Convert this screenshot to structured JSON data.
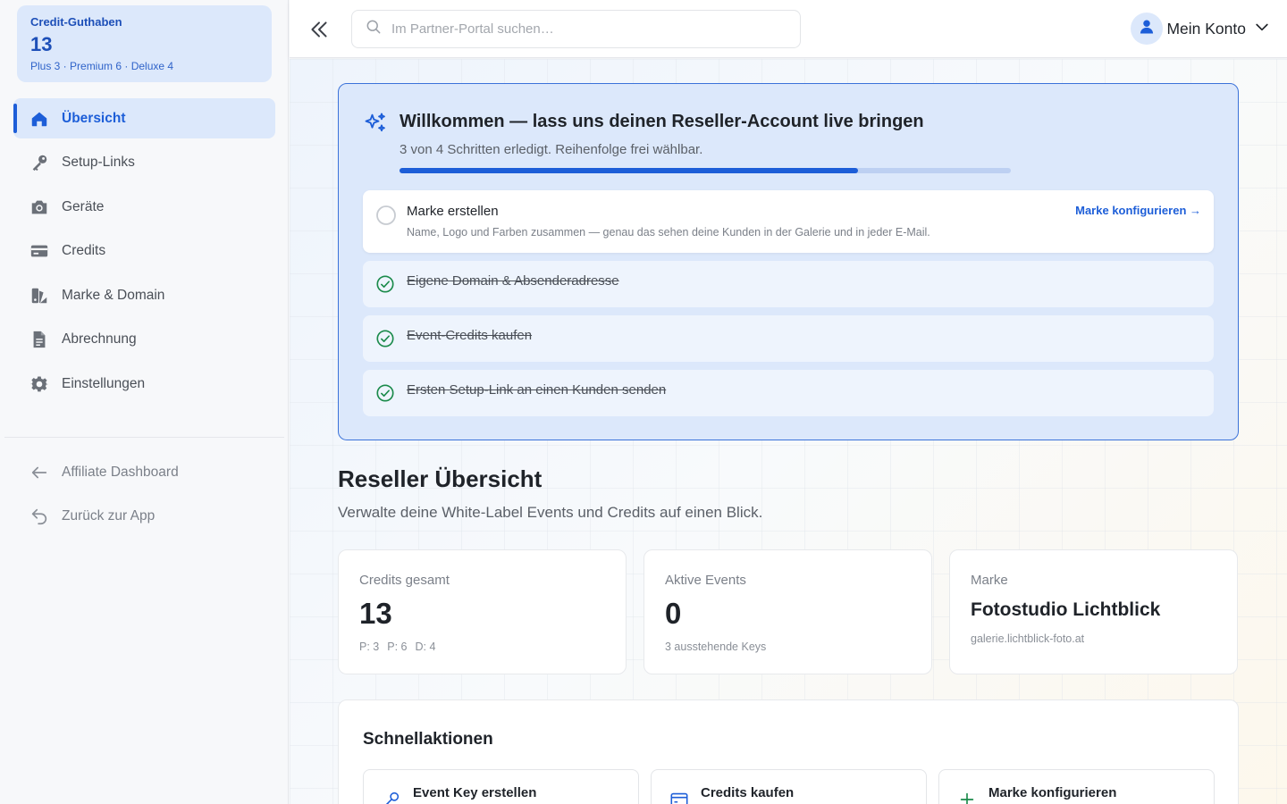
{
  "sidebar": {
    "credit_box": {
      "title": "Credit-Guthaben",
      "value": "13",
      "breakdown": "Plus 3 · Premium 6 · Deluxe 4"
    },
    "items": [
      {
        "label": "Übersicht",
        "icon": "home-icon",
        "active": true
      },
      {
        "label": "Setup-Links",
        "icon": "key-icon"
      },
      {
        "label": "Geräte",
        "icon": "camera-icon"
      },
      {
        "label": "Credits",
        "icon": "credit-card-icon"
      },
      {
        "label": "Marke & Domain",
        "icon": "brand-icon"
      },
      {
        "label": "Abrechnung",
        "icon": "document-icon"
      },
      {
        "label": "Einstellungen",
        "icon": "gear-icon"
      }
    ],
    "secondary_items": [
      {
        "label": "Affiliate Dashboard",
        "icon": "arrow-left-icon"
      },
      {
        "label": "Zurück zur App",
        "icon": "undo-icon"
      }
    ]
  },
  "topbar": {
    "search_placeholder": "Im Partner-Portal suchen…",
    "account_label": "Mein Konto"
  },
  "welcome": {
    "title": "Willkommen — lass uns deinen Reseller-Account live bringen",
    "subtitle": "3 von 4 Schritten erledigt. Reihenfolge frei wählbar.",
    "progress": 0.75,
    "steps": [
      {
        "title": "Marke erstellen",
        "description": "Name, Logo und Farben zusammen — genau das sehen deine Kunden in der Galerie und in jeder E-Mail.",
        "link": "Marke konfigurieren →",
        "done": false
      },
      {
        "title": "Eigene Domain & Absenderadresse",
        "done": true
      },
      {
        "title": "Event-Credits kaufen",
        "done": true
      },
      {
        "title": "Ersten Setup-Link an einen Kunden senden",
        "done": true
      }
    ]
  },
  "overview": {
    "title": "Reseller Übersicht",
    "subtitle": "Verwalte deine White-Label Events und Credits auf einen Blick."
  },
  "stats": {
    "credits": {
      "label": "Credits gesamt",
      "value": "13",
      "p": "P: 3",
      "pr": "P: 6",
      "d": "D: 4"
    },
    "events": {
      "label": "Aktive Events",
      "value": "0",
      "foot": "3 ausstehende Keys"
    },
    "brand": {
      "label": "Marke",
      "value": "Fotostudio Lichtblick",
      "foot": "galerie.lichtblick-foto.at"
    }
  },
  "quick_actions": {
    "title": "Schnellaktionen",
    "items": [
      {
        "label": "Event Key erstellen",
        "icon": "key-icon"
      },
      {
        "label": "Credits kaufen",
        "icon": "credit-card-icon"
      },
      {
        "label": "Marke konfigurieren",
        "icon": "plus-icon"
      }
    ]
  },
  "colors": {
    "accent": "#1d5ed8",
    "accent_light": "#dce8fb",
    "success": "#1a8a4a"
  }
}
